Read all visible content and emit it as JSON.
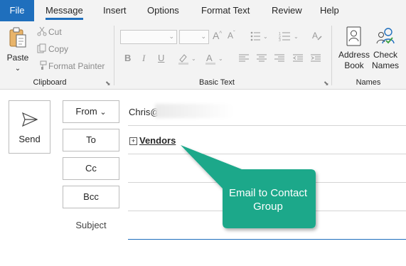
{
  "tabs": [
    "File",
    "Message",
    "Insert",
    "Options",
    "Format Text",
    "Review",
    "Help"
  ],
  "clipboard": {
    "paste": "Paste",
    "cut": "Cut",
    "copy": "Copy",
    "format_painter": "Format Painter",
    "label": "Clipboard"
  },
  "basic_text": {
    "label": "Basic Text",
    "grow": "A",
    "bold": "B",
    "italic": "I",
    "underline": "U",
    "font_color": "A"
  },
  "names": {
    "address_book_1": "Address",
    "address_book_2": "Book",
    "check_names_1": "Check",
    "check_names_2": "Names",
    "label": "Names"
  },
  "compose": {
    "send": "Send",
    "from_button": "From",
    "to_button": "To",
    "cc_button": "Cc",
    "bcc_button": "Bcc",
    "subject_label": "Subject",
    "from_value": "Chris@",
    "to_value": "Vendors",
    "to_expand": "+"
  },
  "callout": {
    "line1": "Email to Contact",
    "line2": "Group",
    "color": "#1aa88a"
  },
  "colors": {
    "file_tab": "#1f6fbd",
    "ribbon_bg": "#f3f3f3"
  }
}
